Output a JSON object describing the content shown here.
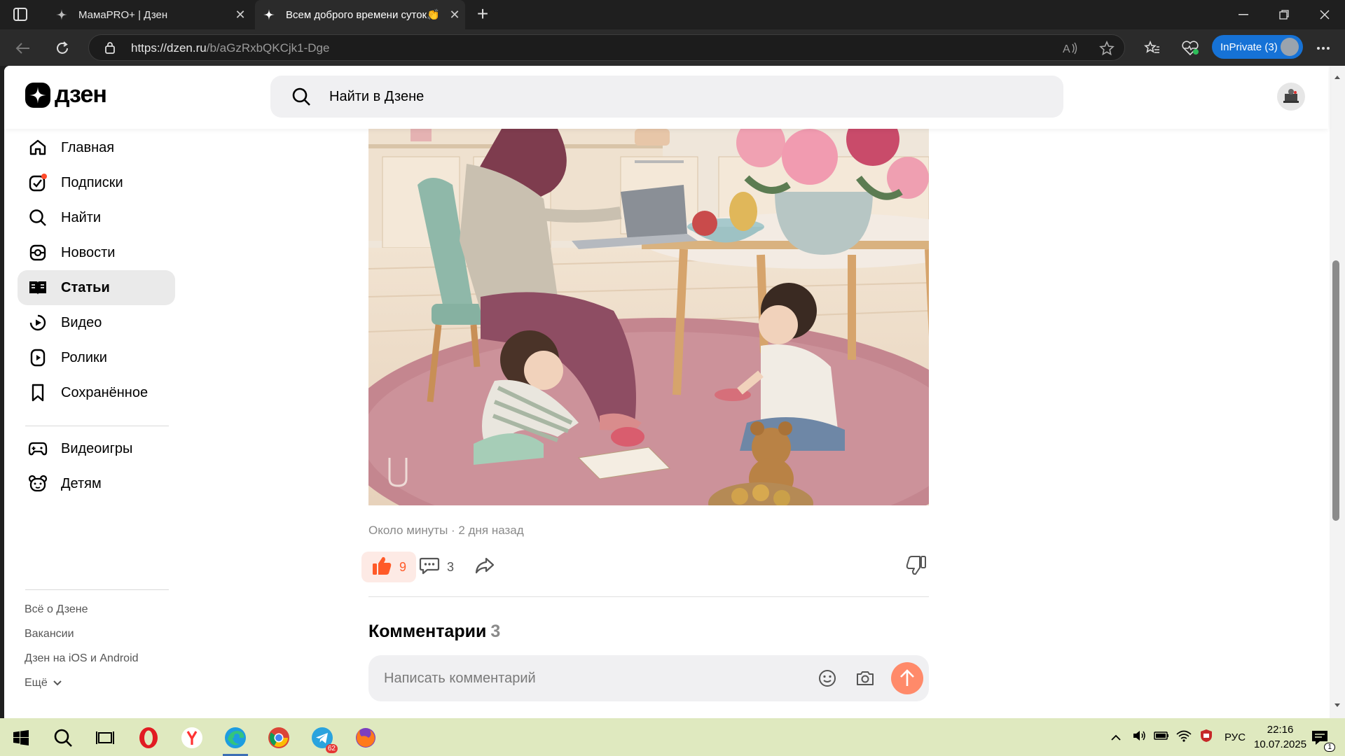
{
  "browser": {
    "tabs": [
      {
        "title": "МамаPRO+ | Дзен",
        "active": false
      },
      {
        "title": "Всем доброго времени суток👏",
        "active": true
      }
    ],
    "url_host": "https://dzen.ru",
    "url_path": "/b/aGzRxbQKCjk1-Dge",
    "inprivate_label": "InPrivate (3)"
  },
  "dzen": {
    "logo_text": "дзен",
    "search_placeholder": "Найти в Дзене",
    "nav": [
      {
        "label": "Главная",
        "icon": "home-icon"
      },
      {
        "label": "Подписки",
        "icon": "subscriptions-icon"
      },
      {
        "label": "Найти",
        "icon": "search-icon"
      },
      {
        "label": "Новости",
        "icon": "news-icon"
      },
      {
        "label": "Статьи",
        "icon": "articles-icon",
        "active": true
      },
      {
        "label": "Видео",
        "icon": "video-icon"
      },
      {
        "label": "Ролики",
        "icon": "shorts-icon"
      },
      {
        "label": "Сохранённое",
        "icon": "bookmark-icon"
      }
    ],
    "nav2": [
      {
        "label": "Видеоигры",
        "icon": "gamepad-icon"
      },
      {
        "label": "Детям",
        "icon": "kids-icon"
      }
    ],
    "footer_links": [
      "Всё о Дзене",
      "Вакансии",
      "Дзен на iOS и Android",
      "Ещё"
    ]
  },
  "article": {
    "meta": "Около минуты · 2 дня назад",
    "likes": "9",
    "comments_count": "3",
    "comments_title": "Комментарии",
    "comments_title_count": "3",
    "comment_placeholder": "Написать комментарий"
  },
  "taskbar": {
    "lang": "РУС",
    "time": "22:16",
    "date": "10.07.2025",
    "telegram_badge": "62",
    "notification_count": "1"
  },
  "colors": {
    "accent": "#ff5a28",
    "inprivate": "#1672d6",
    "taskbar": "#dfe9bf"
  }
}
